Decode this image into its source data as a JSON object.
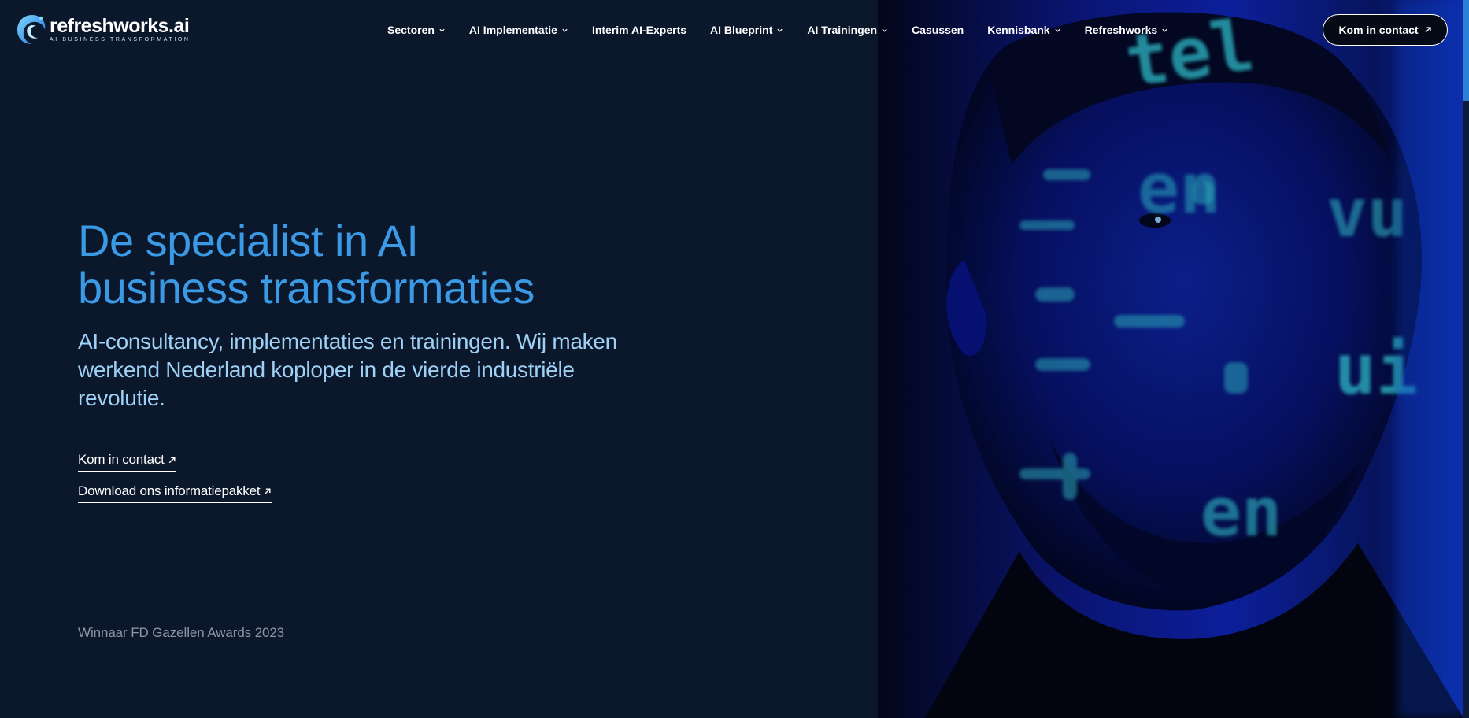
{
  "header": {
    "logo": {
      "word": "refreshworks.ai",
      "tagline": "AI BUSINESS TRANSFORMATION"
    },
    "nav": [
      {
        "label": "Sectoren",
        "has_dropdown": true
      },
      {
        "label": "AI Implementatie",
        "has_dropdown": true
      },
      {
        "label": "Interim AI-Experts",
        "has_dropdown": false
      },
      {
        "label": "AI Blueprint",
        "has_dropdown": true
      },
      {
        "label": "AI Trainingen",
        "has_dropdown": true
      },
      {
        "label": "Casussen",
        "has_dropdown": false
      },
      {
        "label": "Kennisbank",
        "has_dropdown": true
      },
      {
        "label": "Refreshworks",
        "has_dropdown": true
      }
    ],
    "cta_label": "Kom in contact"
  },
  "hero": {
    "title_line1": "De specialist in AI",
    "title_line2": "business transformaties",
    "subtitle": "AI-consultancy, implementaties en trainingen. Wij maken werkend Nederland koploper in de vierde industriële revolutie.",
    "links": [
      {
        "label": "Kom in contact"
      },
      {
        "label": "Download ons informatiepakket"
      }
    ],
    "award": "Winnaar FD Gazellen Awards 2023",
    "image_text_fragments": [
      "tel",
      "en",
      "vu",
      "ui",
      "en"
    ]
  },
  "colors": {
    "background": "#0b172b",
    "accent": "#3b9ae6",
    "subtitle": "#9fd0f5",
    "muted": "#8d96a3",
    "code_glow": "#35c8d6"
  },
  "icons": {
    "logo": "wave-logo-icon",
    "dropdown": "chevron-down-icon",
    "external": "arrow-up-right-icon"
  }
}
